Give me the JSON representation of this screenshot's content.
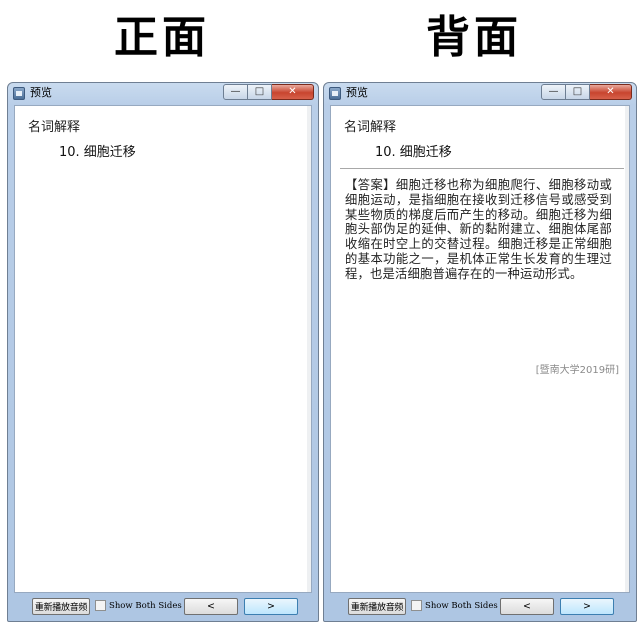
{
  "headings": {
    "front": "正面",
    "back": "背面"
  },
  "window": {
    "title": "预览",
    "controls": {
      "minimize": "—",
      "maximize": "□",
      "close": "✕"
    }
  },
  "card": {
    "category": "名词解释",
    "term": "10. 细胞迁移",
    "answer": "【答案】细胞迁移也称为细胞爬行、细胞移动或细胞运动，是指细胞在接收到迁移信号或感受到某些物质的梯度后而产生的移动。细胞迁移为细胞头部伪足的延伸、新的黏附建立、细胞体尾部收缩在时空上的交替过程。细胞迁移是正常细胞的基本功能之一，是机体正常生长发育的生理过程，也是活细胞普遍存在的一种运动形式。",
    "source": "[暨南大学2019研]"
  },
  "footer": {
    "replay_label": "重新播放音频",
    "show_both_label": "Show Both Sides",
    "show_both_checked": false,
    "prev_label": "<",
    "next_label": ">"
  },
  "colors": {
    "titlebar": "#b9cee8",
    "close_button": "#c8452f",
    "source_text": "#8a8a8a"
  }
}
